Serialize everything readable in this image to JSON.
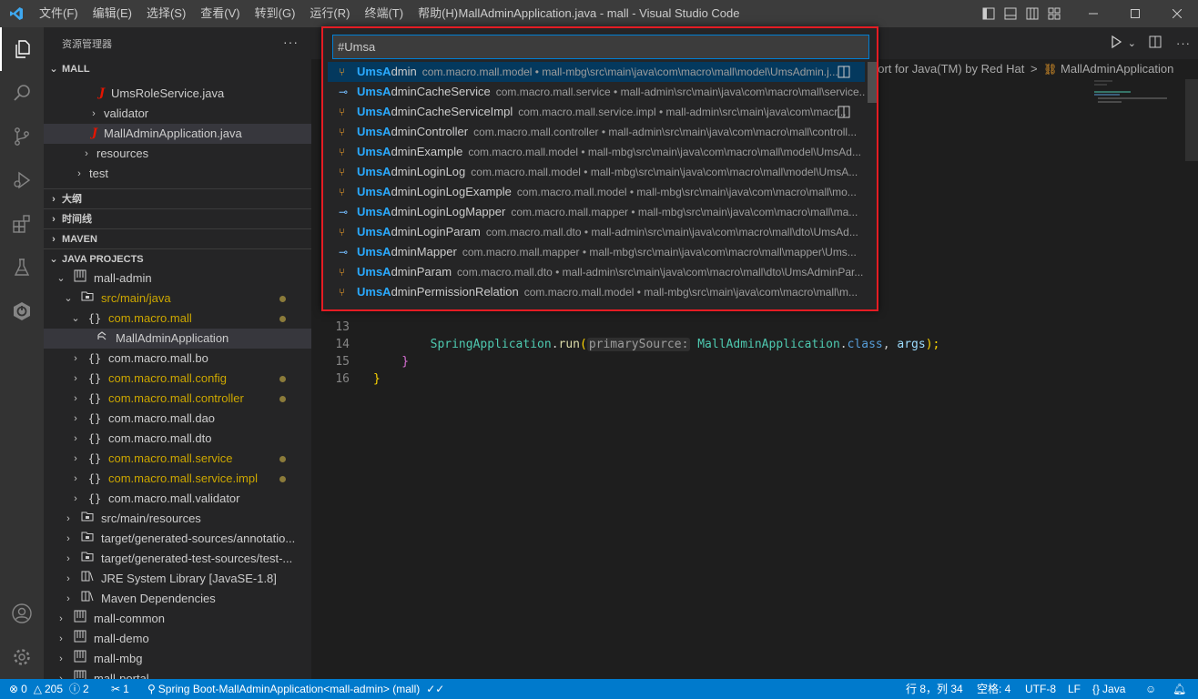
{
  "window": {
    "title": "MallAdminApplication.java - mall - Visual Studio Code",
    "menu": [
      "文件(F)",
      "编辑(E)",
      "选择(S)",
      "查看(V)",
      "转到(G)",
      "运行(R)",
      "终端(T)",
      "帮助(H)"
    ]
  },
  "sidebar": {
    "title": "资源管理器",
    "more": "···",
    "workspace": "MALL",
    "top_items": [
      {
        "label": "UmsRoleService.java"
      },
      {
        "label": "validator"
      },
      {
        "label": "MallAdminApplication.java"
      },
      {
        "label": "resources"
      },
      {
        "label": "test"
      }
    ],
    "sections": [
      "大纲",
      "时间线",
      "MAVEN",
      "JAVA PROJECTS"
    ],
    "projects": [
      {
        "label": "mall-admin"
      },
      {
        "label": "src/main/java"
      },
      {
        "label": "com.macro.mall"
      },
      {
        "label": "MallAdminApplication"
      },
      {
        "label": "com.macro.mall.bo"
      },
      {
        "label": "com.macro.mall.config"
      },
      {
        "label": "com.macro.mall.controller"
      },
      {
        "label": "com.macro.mall.dao"
      },
      {
        "label": "com.macro.mall.dto"
      },
      {
        "label": "com.macro.mall.service"
      },
      {
        "label": "com.macro.mall.service.impl"
      },
      {
        "label": "com.macro.mall.validator"
      },
      {
        "label": "src/main/resources"
      },
      {
        "label": "target/generated-sources/annotatio..."
      },
      {
        "label": "target/generated-test-sources/test-..."
      },
      {
        "label": "JRE System Library [JavaSE-1.8]"
      },
      {
        "label": "Maven Dependencies"
      },
      {
        "label": "mall-common"
      },
      {
        "label": "mall-demo"
      },
      {
        "label": "mall-mbg"
      },
      {
        "label": "mall-portal"
      }
    ]
  },
  "editor": {
    "breadcrumb": {
      "part1": "port for Java(TM) by Red Hat",
      "sep": ">",
      "part2": "MallAdminApplication"
    },
    "lines": [
      {
        "num": "13",
        "indent": "        ",
        "cls": "SpringApplication",
        "dot": ".",
        "fn": "run",
        "open": "(",
        "hint": "primarySource:",
        "arg": " MallAdminApplication",
        "dot2": ".",
        "kw": "class",
        "comma": ", ",
        "var": "args",
        "close": ");"
      },
      {
        "num": "14",
        "text": "    }"
      },
      {
        "num": "15",
        "text": "}"
      },
      {
        "num": "16",
        "text": ""
      }
    ]
  },
  "quickopen": {
    "query": "#Umsa",
    "items": [
      {
        "hl": "UmsA",
        "rest": "dmin",
        "desc": "com.macro.mall.model • mall-mbg\\src\\main\\java\\com\\macro\\mall\\model\\UmsAdmin.j...",
        "icon": "class-icon"
      },
      {
        "hl": "UmsA",
        "rest": "dminCacheService",
        "desc": "com.macro.mall.service • mall-admin\\src\\main\\java\\com\\macro\\mall\\service...",
        "icon": "interface-icon"
      },
      {
        "hl": "UmsA",
        "rest": "dminCacheServiceImpl",
        "desc": "com.macro.mall.service.impl • mall-admin\\src\\main\\java\\com\\macr...",
        "icon": "class-icon"
      },
      {
        "hl": "UmsA",
        "rest": "dminController",
        "desc": "com.macro.mall.controller • mall-admin\\src\\main\\java\\com\\macro\\mall\\controll...",
        "icon": "class-icon"
      },
      {
        "hl": "UmsA",
        "rest": "dminExample",
        "desc": "com.macro.mall.model • mall-mbg\\src\\main\\java\\com\\macro\\mall\\model\\UmsAd...",
        "icon": "class-icon"
      },
      {
        "hl": "UmsA",
        "rest": "dminLoginLog",
        "desc": "com.macro.mall.model • mall-mbg\\src\\main\\java\\com\\macro\\mall\\model\\UmsA...",
        "icon": "class-icon"
      },
      {
        "hl": "UmsA",
        "rest": "dminLoginLogExample",
        "desc": "com.macro.mall.model • mall-mbg\\src\\main\\java\\com\\macro\\mall\\mo...",
        "icon": "class-icon"
      },
      {
        "hl": "UmsA",
        "rest": "dminLoginLogMapper",
        "desc": "com.macro.mall.mapper • mall-mbg\\src\\main\\java\\com\\macro\\mall\\ma...",
        "icon": "interface-icon"
      },
      {
        "hl": "UmsA",
        "rest": "dminLoginParam",
        "desc": "com.macro.mall.dto • mall-admin\\src\\main\\java\\com\\macro\\mall\\dto\\UmsAd...",
        "icon": "class-icon"
      },
      {
        "hl": "UmsA",
        "rest": "dminMapper",
        "desc": "com.macro.mall.mapper • mall-mbg\\src\\main\\java\\com\\macro\\mall\\mapper\\Ums...",
        "icon": "interface-icon"
      },
      {
        "hl": "UmsA",
        "rest": "dminParam",
        "desc": "com.macro.mall.dto • mall-admin\\src\\main\\java\\com\\macro\\mall\\dto\\UmsAdminPar...",
        "icon": "class-icon"
      },
      {
        "hl": "UmsA",
        "rest": "dminPermissionRelation",
        "desc": "com.macro.mall.model • mall-mbg\\src\\main\\java\\com\\macro\\mall\\m...",
        "icon": "class-icon"
      }
    ]
  },
  "statusbar": {
    "errors": "0",
    "warnings": "205",
    "infos": "2",
    "tools": "1",
    "spring": "Spring Boot-MallAdminApplication<mall-admin> (mall)",
    "position": "行 8，列 34",
    "spaces": "空格: 4",
    "encoding": "UTF-8",
    "eol": "LF",
    "language": "Java"
  },
  "colors": {
    "accent": "#007acc",
    "highlight": "#2aaaff",
    "annotation_border": "#e51c23"
  }
}
